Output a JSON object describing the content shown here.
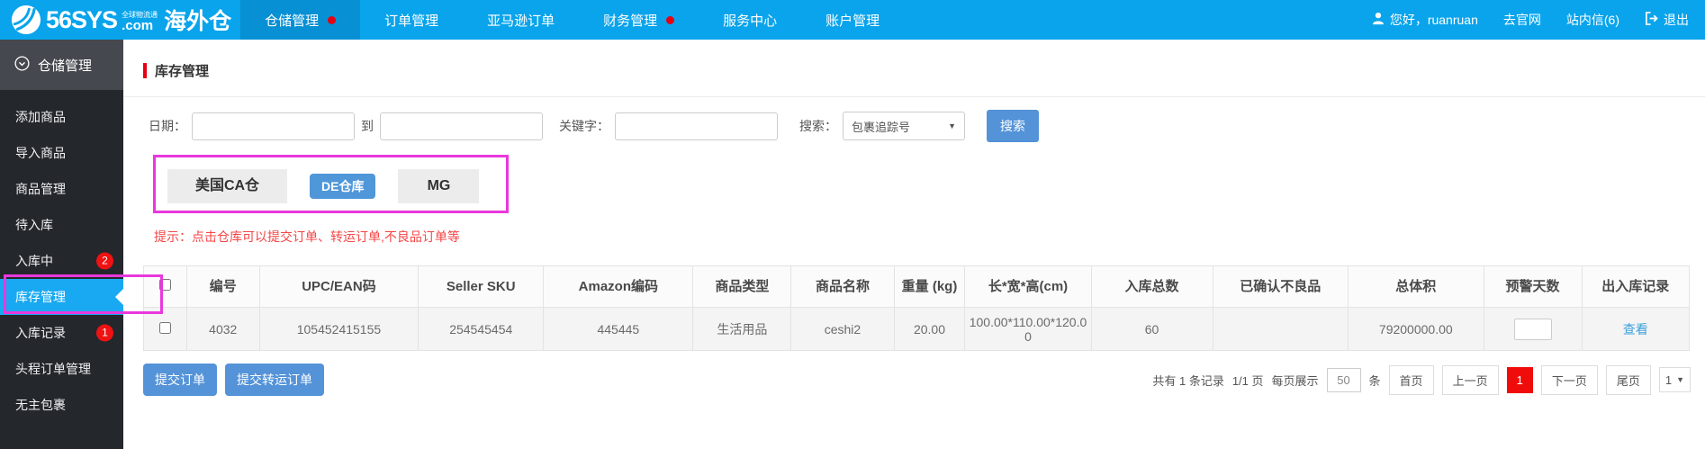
{
  "header": {
    "logo": {
      "brand": "56SYS",
      "tagline": "全球物流通",
      "suffix": ".com",
      "product": "海外仓"
    },
    "nav": [
      {
        "label": "仓储管理",
        "dot": true,
        "active": true
      },
      {
        "label": "订单管理"
      },
      {
        "label": "亚马逊订单"
      },
      {
        "label": "财务管理",
        "dot": true
      },
      {
        "label": "服务中心"
      },
      {
        "label": "账户管理"
      }
    ],
    "user": {
      "greeting": "您好，ruanruan",
      "official_site": "去官网",
      "messages": "站内信(6)",
      "logout": "退出"
    }
  },
  "sidebar": {
    "header": "仓储管理",
    "items": [
      {
        "label": "添加商品"
      },
      {
        "label": "导入商品"
      },
      {
        "label": "商品管理"
      },
      {
        "label": "待入库"
      },
      {
        "label": "入库中",
        "badge": "2"
      },
      {
        "label": "库存管理",
        "active": true
      },
      {
        "label": "入库记录",
        "badge": "1"
      },
      {
        "label": "头程订单管理"
      },
      {
        "label": "无主包裹"
      }
    ]
  },
  "main": {
    "page_title": "库存管理",
    "filters": {
      "date_label": "日期：",
      "to_label": "到",
      "keyword_label": "关键字：",
      "search_label": "搜索：",
      "search_type_selected": "包裹追踪号",
      "search_button": "搜索"
    },
    "warehouses": [
      {
        "label": "美国CA仓"
      },
      {
        "label": "DE仓库",
        "active": true
      },
      {
        "label": "MG"
      }
    ],
    "hint": "提示：点击仓库可以提交订单、转运订单,不良品订单等",
    "table": {
      "headers": [
        "编号",
        "UPC/EAN码",
        "Seller SKU",
        "Amazon编码",
        "商品类型",
        "商品名称",
        "重量 (kg)",
        "长*宽*高(cm)",
        "入库总数",
        "已确认不良品",
        "总体积",
        "预警天数",
        "出入库记录"
      ],
      "rows": [
        {
          "id": "4032",
          "upc": "105452415155",
          "seller_sku": "254545454",
          "amazon_code": "445445",
          "type": "生活用品",
          "name": "ceshi2",
          "weight": "20.00",
          "dimensions": "100.00*110.00*120.00",
          "total_in": "60",
          "confirmed_bad": "",
          "volume": "79200000.00",
          "warn_days": "",
          "record_link": "查看"
        }
      ]
    },
    "actions": {
      "submit_order": "提交订单",
      "submit_transfer": "提交转运订单"
    },
    "pagination": {
      "summary": "共有 1 条记录",
      "page_info": "1/1 页",
      "per_page_label": "每页展示",
      "per_page_value": "50",
      "per_page_unit": "条",
      "first": "首页",
      "prev": "上一页",
      "current": "1",
      "next": "下一页",
      "last": "尾页",
      "page_select": "1"
    }
  },
  "ui": {
    "caret": "▼"
  },
  "colors": {
    "header_blue": "#09a4ec",
    "nav_active_blue": "#0790d4",
    "sidebar_dark": "#24272c",
    "sidebar_active_blue": "#19a9f2",
    "annotation_magenta": "#e838dc",
    "badge_red": "#f01212",
    "accent_red": "#e60012",
    "button_blue": "#5493d8",
    "current_page_red": "#f10c0c",
    "link_blue": "#3b9fd9"
  }
}
